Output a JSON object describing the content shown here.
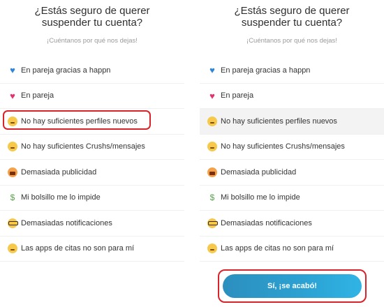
{
  "title_line1": "¿Estás seguro de querer",
  "title_line2": "suspender tu cuenta?",
  "subtitle": "¡Cuéntanos por qué nos dejas!",
  "reasons": [
    {
      "label": "En pareja gracias a happn",
      "icon": "blue-heart-icon"
    },
    {
      "label": "En pareja",
      "icon": "two-hearts-icon"
    },
    {
      "label": "No hay suficientes perfiles nuevos",
      "icon": "worried-face-icon"
    },
    {
      "label": "No hay suficientes Crushs/mensajes",
      "icon": "worried-face-icon"
    },
    {
      "label": "Demasiada publicidad",
      "icon": "screaming-face-icon"
    },
    {
      "label": "Mi bolsillo me lo impide",
      "icon": "money-with-wings-icon"
    },
    {
      "label": "Demasiadas notificaciones",
      "icon": "nerd-face-icon"
    },
    {
      "label": "Las apps de citas no son para mí",
      "icon": "neutral-face-icon"
    }
  ],
  "selected_reason_index": 2,
  "confirm_button_label": "Sí, ¡se acabó!",
  "colors": {
    "accent_gradient_start": "#2c8fbe",
    "accent_gradient_end": "#30b4e4",
    "highlight": "#d8232a",
    "selected_row_bg": "#f3f3f3"
  }
}
